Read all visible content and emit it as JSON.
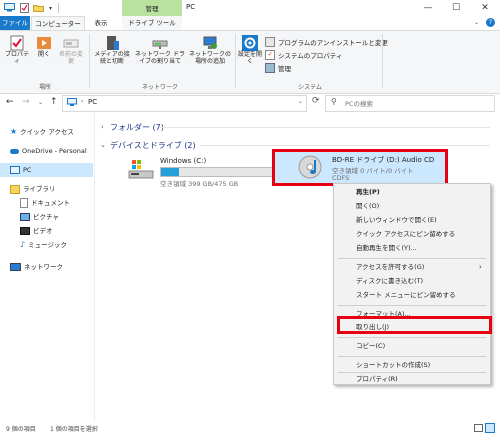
{
  "titlebar": {
    "title": "PC",
    "context_tab_group": "管理",
    "min_glyph": "—",
    "max_glyph": "☐",
    "close_glyph": "✕"
  },
  "tabs": {
    "file": "ファイル",
    "computer": "コンピューター",
    "view": "表示",
    "drive_tools": "ドライブ ツール"
  },
  "ribbon": {
    "location": {
      "properties": "プロパティ",
      "open": "開く",
      "rename": "名前の変更",
      "group": "場所"
    },
    "network": {
      "media": "メディアの接続と切断",
      "map_drive": "ネットワーク ドライブの割り当て",
      "add_location": "ネットワークの場所の追加",
      "group": "ネットワーク"
    },
    "system": {
      "settings": "設定を開く",
      "uninstall": "プログラムのアンインストールと変更",
      "sys_props": "システムのプロパティ",
      "manage": "管理",
      "group": "システム"
    }
  },
  "address": {
    "path": "PC",
    "search_placeholder": "PCの検索"
  },
  "nav": {
    "quick_access": "クイック アクセス",
    "onedrive": "OneDrive - Personal",
    "pc": "PC",
    "libraries": "ライブラリ",
    "documents": "ドキュメント",
    "pictures": "ピクチャ",
    "videos": "ビデオ",
    "music": "ミュージック",
    "network": "ネットワーク"
  },
  "content": {
    "folders_header": "フォルダー (7)",
    "devices_header": "デバイスとドライブ (2)",
    "drive_c": {
      "name": "Windows (C:)",
      "free": "空き領域 399 GB/475 GB",
      "fill": 0.16
    },
    "drive_d": {
      "name": "BD-RE ドライブ (D:) Audio CD",
      "free": "空き領域 0 バイト/0 バイト",
      "fs": "CDFS"
    }
  },
  "context_menu": {
    "play": "再生(P)",
    "open": "開く(O)",
    "open_new_window": "新しいウィンドウで開く(E)",
    "pin_quick": "クイック アクセスにピン留めする",
    "autoplay": "自動再生を開く(Y)...",
    "give_access": "アクセスを許可する(G)",
    "burn": "ディスクに書き込む(T)",
    "pin_start": "スタート メニューにピン留めする",
    "format": "フォーマット(A)...",
    "eject": "取り出し(J)",
    "copy": "コピー(C)",
    "create_shortcut": "ショートカットの作成(S)",
    "properties": "プロパティ(R)"
  },
  "statusbar": {
    "count": "9 個の項目",
    "selected": "1 個の項目を選択"
  },
  "colors": {
    "accent": "#1979ca",
    "highlight_red": "#e60012",
    "context_tab": "#b8e29d",
    "selection": "#cce8ff"
  }
}
